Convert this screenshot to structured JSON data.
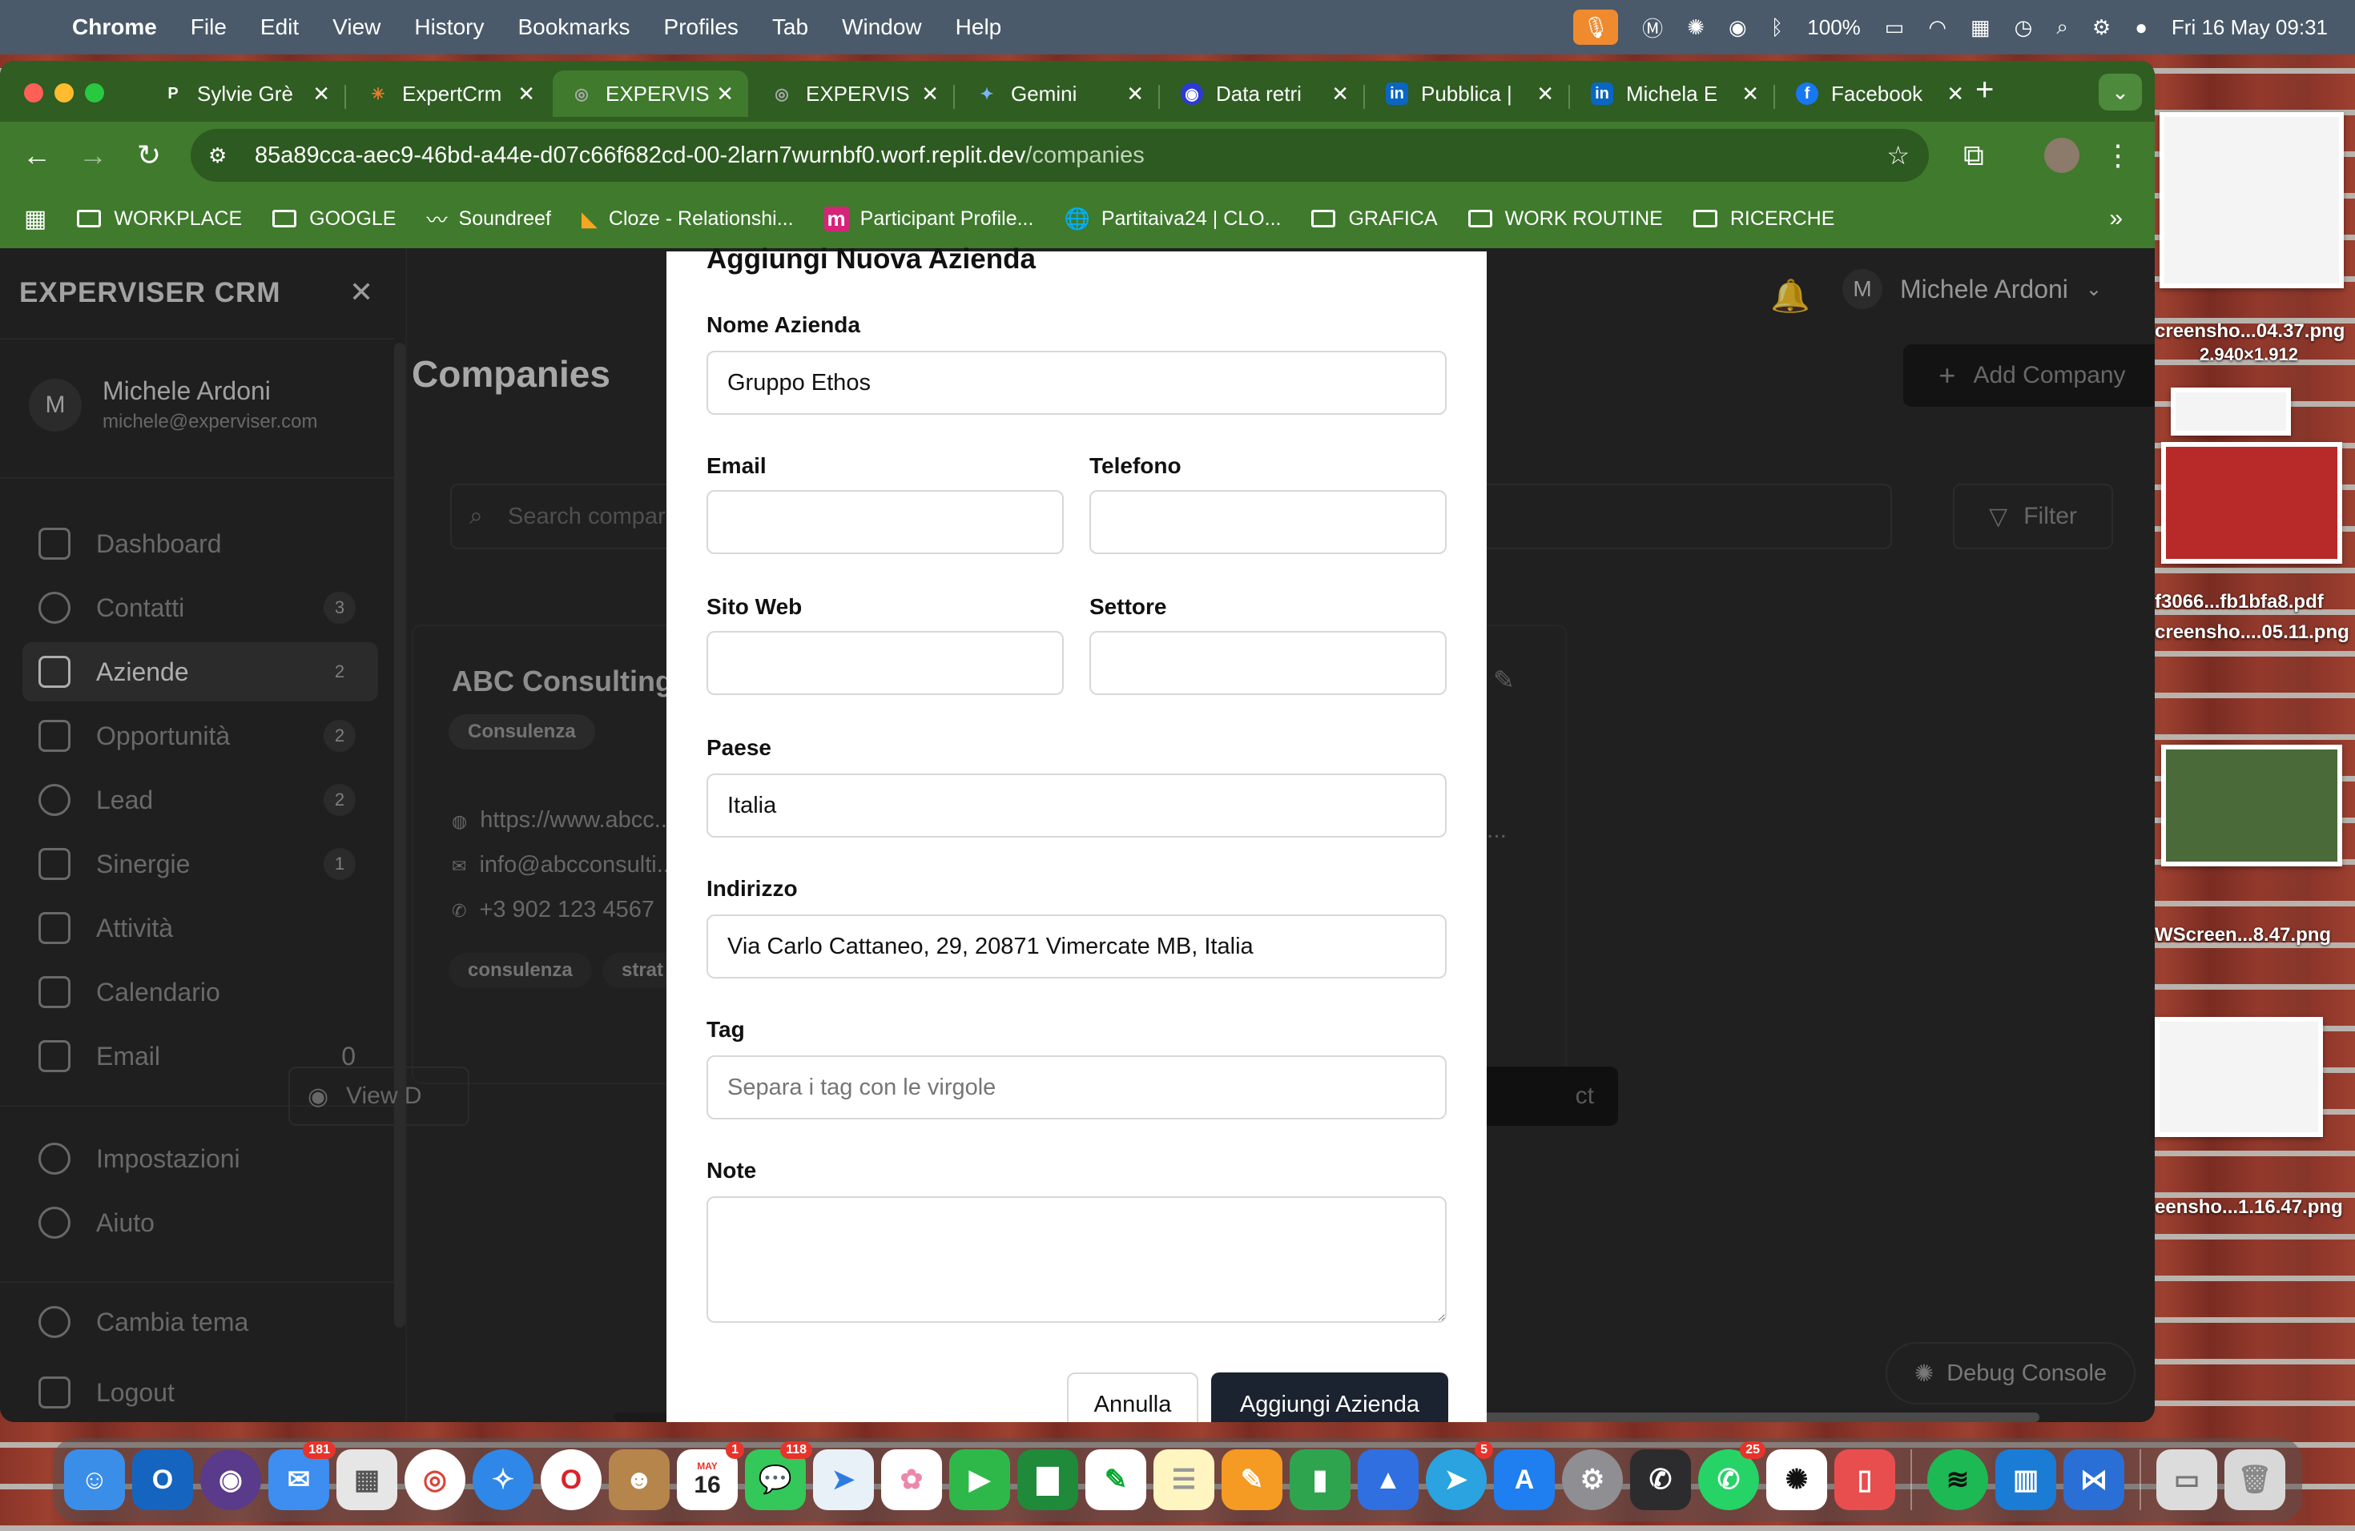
{
  "menubar": {
    "app_name": "Chrome",
    "menus": [
      "File",
      "Edit",
      "View",
      "History",
      "Bookmarks",
      "Profiles",
      "Tab",
      "Window",
      "Help"
    ],
    "battery": "100%",
    "datetime": "Fri 16 May  09:31"
  },
  "browser": {
    "tabs": [
      {
        "title": "Sylvie Grè",
        "favicon": "P"
      },
      {
        "title": "ExpertCrm",
        "favicon": "✳"
      },
      {
        "title": "EXPERVIS",
        "favicon": "◎"
      },
      {
        "title": "EXPERVIS",
        "favicon": "◎"
      },
      {
        "title": "Gemini",
        "favicon": "✦"
      },
      {
        "title": "Data retri",
        "favicon": "◉"
      },
      {
        "title": "Pubblica |",
        "favicon": "in"
      },
      {
        "title": "Michela E",
        "favicon": "in"
      },
      {
        "title": "Facebook",
        "favicon": "f"
      }
    ],
    "url_main": "85a89cca-aec9-46bd-a44e-d07c66f682cd-00-2larn7wurnbf0.worf.replit.dev",
    "url_path": "/companies",
    "bookmarks": [
      {
        "label": "WORKPLACE",
        "icon": "folder"
      },
      {
        "label": "GOOGLE",
        "icon": "folder"
      },
      {
        "label": "Soundreef",
        "icon": "bird"
      },
      {
        "label": "Cloze - Relationshi...",
        "icon": "cloze"
      },
      {
        "label": "Participant Profile...",
        "icon": "m"
      },
      {
        "label": "Partitaiva24 | CLO...",
        "icon": "globe"
      },
      {
        "label": "GRAFICA",
        "icon": "folder"
      },
      {
        "label": "WORK ROUTINE",
        "icon": "folder"
      },
      {
        "label": "RICERCHE",
        "icon": "folder"
      }
    ]
  },
  "sidebar": {
    "title": "EXPERVISER CRM",
    "user_initial": "M",
    "user_name": "Michele Ardoni",
    "user_email": "michele@experviser.com",
    "items": [
      {
        "label": "Dashboard",
        "count": ""
      },
      {
        "label": "Contatti",
        "count": "3"
      },
      {
        "label": "Aziende",
        "count": "2",
        "active": true
      },
      {
        "label": "Opportunità",
        "count": "2"
      },
      {
        "label": "Lead",
        "count": "2"
      },
      {
        "label": "Sinergie",
        "count": "1"
      },
      {
        "label": "Attività",
        "count": ""
      },
      {
        "label": "Calendario",
        "count": ""
      },
      {
        "label": "Email",
        "count": "0"
      }
    ],
    "bottom_items": [
      "Impostazioni",
      "Aiuto"
    ],
    "theme_label": "Cambia tema",
    "logout_label": "Logout"
  },
  "header": {
    "user_initial": "M",
    "user_name": "Michele Ardoni",
    "page_title": "Companies",
    "add_button": "Add Company",
    "search_placeholder": "Search compar",
    "filter_label": "Filter"
  },
  "company_card": {
    "name": "ABC Consulting",
    "category": "Consulenza",
    "website": "https://www.abcc...",
    "email": "info@abcconsulti...",
    "phone": "+3 902 123 4567",
    "tags": [
      "consulenza",
      "strat"
    ],
    "view_label": "View D",
    "right_button": "ct",
    "ellipsis": "..."
  },
  "debug_label": "Debug Console",
  "modal": {
    "title": "Aggiungi Nuova Azienda",
    "fields": {
      "nome": {
        "label": "Nome Azienda",
        "value": "Gruppo Ethos"
      },
      "email": {
        "label": "Email",
        "value": ""
      },
      "telefono": {
        "label": "Telefono",
        "value": ""
      },
      "sito": {
        "label": "Sito Web",
        "value": ""
      },
      "settore": {
        "label": "Settore",
        "value": ""
      },
      "paese": {
        "label": "Paese",
        "value": "Italia"
      },
      "indirizzo": {
        "label": "Indirizzo",
        "value": "Via Carlo Cattaneo, 29, 20871 Vimercate MB, Italia"
      },
      "tag": {
        "label": "Tag",
        "value": "",
        "placeholder": "Separa i tag con le virgole"
      },
      "note": {
        "label": "Note",
        "value": ""
      }
    },
    "cancel_label": "Annulla",
    "submit_label": "Aggiungi Azienda"
  },
  "desktop_files": [
    {
      "label": "creensho...04.37.png",
      "sub": "2.940×1.912"
    },
    {
      "label": "f3066...fb1bfa8.pdf"
    },
    {
      "label": "creensho....05.11.png"
    },
    {
      "label": "WScreen...8.47.png"
    },
    {
      "label": "eensho...1.16.47.png"
    }
  ],
  "dock": {
    "badges": {
      "mail": "181",
      "calendar": "1",
      "messages": "118",
      "telegram": "5",
      "whatsapp": "25"
    },
    "calendar_month": "MAY",
    "calendar_day": "16"
  }
}
